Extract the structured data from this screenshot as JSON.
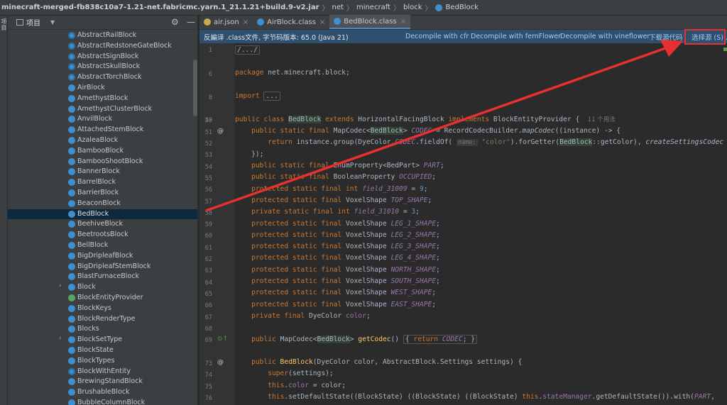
{
  "breadcrumb": [
    "minecraft-merged-fb838c10a7-1.21-net.fabricmc.yarn.1_21.1.21+build.9-v2.jar",
    "net",
    "minecraft",
    "block",
    "BedBlock"
  ],
  "left_strip_label": "项目",
  "project_panel": {
    "title": "项目"
  },
  "tree_items": [
    {
      "label": "AbstractRailBlock",
      "kind": "abstract"
    },
    {
      "label": "AbstractRedstoneGateBlock",
      "kind": "abstract"
    },
    {
      "label": "AbstractSignBlock",
      "kind": "abstract"
    },
    {
      "label": "AbstractSkullBlock",
      "kind": "abstract"
    },
    {
      "label": "AbstractTorchBlock",
      "kind": "abstract"
    },
    {
      "label": "AirBlock",
      "kind": "class"
    },
    {
      "label": "AmethystBlock",
      "kind": "class"
    },
    {
      "label": "AmethystClusterBlock",
      "kind": "class"
    },
    {
      "label": "AnvilBlock",
      "kind": "class"
    },
    {
      "label": "AttachedStemBlock",
      "kind": "class"
    },
    {
      "label": "AzaleaBlock",
      "kind": "class"
    },
    {
      "label": "BambooBlock",
      "kind": "class"
    },
    {
      "label": "BambooShootBlock",
      "kind": "class"
    },
    {
      "label": "BannerBlock",
      "kind": "class"
    },
    {
      "label": "BarrelBlock",
      "kind": "class"
    },
    {
      "label": "BarrierBlock",
      "kind": "class"
    },
    {
      "label": "BeaconBlock",
      "kind": "class"
    },
    {
      "label": "BedBlock",
      "kind": "class",
      "selected": true
    },
    {
      "label": "BeehiveBlock",
      "kind": "class"
    },
    {
      "label": "BeetrootsBlock",
      "kind": "class"
    },
    {
      "label": "BellBlock",
      "kind": "class"
    },
    {
      "label": "BigDripleafBlock",
      "kind": "class"
    },
    {
      "label": "BigDripleafStemBlock",
      "kind": "class"
    },
    {
      "label": "BlastFurnaceBlock",
      "kind": "class"
    },
    {
      "label": "Block",
      "kind": "class",
      "expandable": true
    },
    {
      "label": "BlockEntityProvider",
      "kind": "iface"
    },
    {
      "label": "BlockKeys",
      "kind": "class"
    },
    {
      "label": "BlockRenderType",
      "kind": "enum"
    },
    {
      "label": "Blocks",
      "kind": "class"
    },
    {
      "label": "BlockSetType",
      "kind": "class",
      "expandable": true
    },
    {
      "label": "BlockState",
      "kind": "class"
    },
    {
      "label": "BlockTypes",
      "kind": "class"
    },
    {
      "label": "BlockWithEntity",
      "kind": "abstract"
    },
    {
      "label": "BrewingStandBlock",
      "kind": "class"
    },
    {
      "label": "BrushableBlock",
      "kind": "class"
    },
    {
      "label": "BubbleColumnBlock",
      "kind": "class"
    }
  ],
  "tabs": [
    {
      "label": "air.json",
      "icon": "json-file-icon",
      "color": "#c9a94b"
    },
    {
      "label": "AirBlock.class",
      "icon": "class-file-icon",
      "color": "#3d8fcf"
    },
    {
      "label": "BedBlock.class",
      "icon": "class-file-icon",
      "color": "#3d8fcf",
      "active": true
    }
  ],
  "notice": {
    "text": "反編译 .class文件, 字节码版本: 65.0 (Java 21)",
    "links": [
      "Decompile with cfr",
      "Decompile with fernFlower",
      "Decompile with vineflower",
      "下载源代码",
      "选择源 (S)..."
    ]
  },
  "line_numbers": [
    "1",
    "",
    "6",
    "",
    "8",
    "",
    "49",
    "50",
    "51",
    "52",
    "53",
    "54",
    "55",
    "56",
    "57",
    "58",
    "59",
    "60",
    "61",
    "62",
    "63",
    "64",
    "65",
    "66",
    "67",
    "68",
    "69",
    "",
    "73",
    "74",
    "75",
    "76"
  ],
  "usage_hint": "11 个用法",
  "param_hint": "name:",
  "colors": {
    "accent": "#4a88c7",
    "annotation_red": "#e83030",
    "selection": "#0d293e"
  }
}
